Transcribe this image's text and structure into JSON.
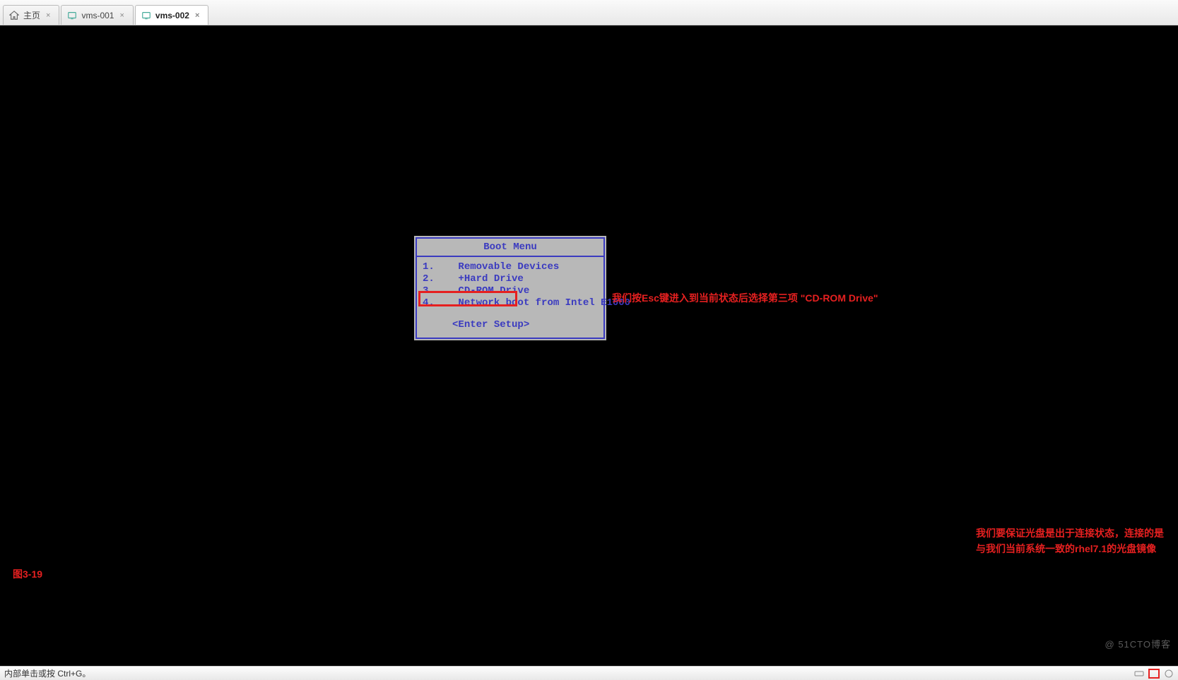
{
  "tabs": [
    {
      "label": "主页",
      "icon": "home",
      "active": false
    },
    {
      "label": "vms-001",
      "icon": "vm",
      "active": false
    },
    {
      "label": "vms-002",
      "icon": "vm",
      "active": true
    }
  ],
  "boot_menu": {
    "title": "Boot Menu",
    "items": [
      {
        "num": "1.",
        "label": "Removable Devices"
      },
      {
        "num": "2.",
        "label": "+Hard Drive"
      },
      {
        "num": "3.",
        "label": "CD-ROM Drive"
      },
      {
        "num": "4.",
        "label": "Network boot from Intel E1000"
      }
    ],
    "enter_setup": "<Enter Setup>"
  },
  "annotations": {
    "main": "我们按Esc键进入到当前状态后选择第三项 \"CD-ROM Drive\"",
    "bottom_line1": "我们要保证光盘是出于连接状态，连接的是",
    "bottom_line2": "与我们当前系统一致的rhel7.1的光盘镜像",
    "caption": "图3-19"
  },
  "status_bar": {
    "hint": "内部单击或按 Ctrl+G。",
    "watermark": "@ 51CTO博客"
  }
}
